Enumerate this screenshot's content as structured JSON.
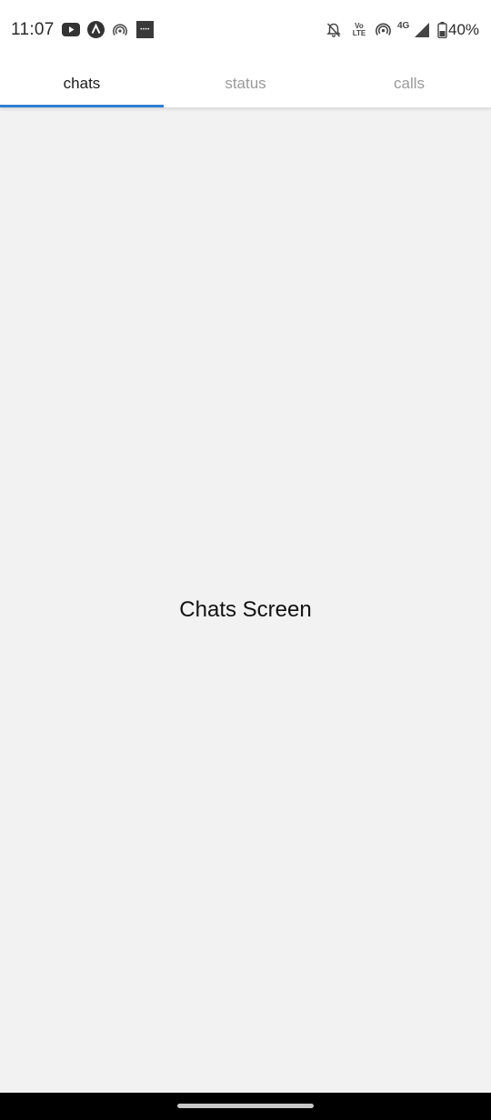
{
  "status_bar": {
    "time": "11:07",
    "left_icons": [
      "youtube-icon",
      "app-lambda-icon",
      "hotspot-icon",
      "app-badge-icon"
    ],
    "app_badge_text": "••••",
    "right_icons": [
      "bell-off-icon",
      "volte-icon",
      "hotspot-icon",
      "signal-icon",
      "battery-icon"
    ],
    "volte_top": "Vo",
    "volte_bottom": "LTE",
    "network": "4G",
    "battery_percent": "40%"
  },
  "tabs": [
    {
      "label": "chats",
      "active": true
    },
    {
      "label": "status",
      "active": false
    },
    {
      "label": "calls",
      "active": false
    }
  ],
  "main": {
    "title": "Chats Screen"
  },
  "colors": {
    "tab_indicator": "#2f80d1",
    "background": "#f2f2f2",
    "tab_active_text": "#1a1a1a",
    "tab_inactive_text": "#9a9a9a"
  }
}
